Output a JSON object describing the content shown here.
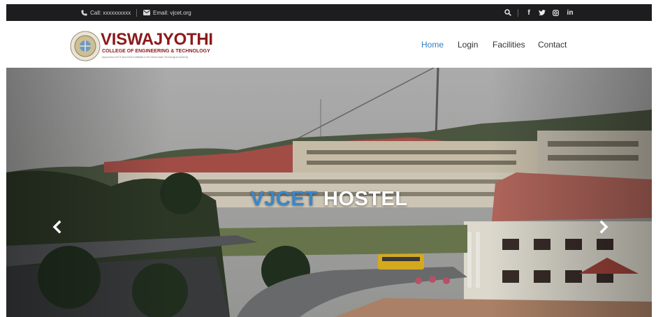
{
  "topbar": {
    "call_label": "Call: xxxxxxxxxx",
    "email_label": "Email: vjcet.org",
    "social": [
      {
        "icon": "facebook-icon",
        "glyph": "f"
      },
      {
        "icon": "twitter-icon",
        "glyph": "🐦"
      },
      {
        "icon": "instagram-icon",
        "glyph": "◎"
      },
      {
        "icon": "linkedin-icon",
        "glyph": "in"
      }
    ]
  },
  "logo": {
    "name": "VISWAJYOTHI",
    "subtitle": "COLLEGE OF ENGINEERING & TECHNOLOGY",
    "tagline": "Approved by AICTE New Delhi & Affiliated to APJ Abdul Kalam Technological University"
  },
  "nav": {
    "items": [
      {
        "label": "Home"
      },
      {
        "label": "Login"
      },
      {
        "label": "Facilities"
      },
      {
        "label": "Contact"
      }
    ]
  },
  "hero": {
    "title_part1": "VJCET",
    "title_part2": "HOSTEL"
  },
  "colors": {
    "accent": "#2f7fc1",
    "topbar_bg": "#1d1d1f",
    "logo_red": "#8b1a1a"
  }
}
